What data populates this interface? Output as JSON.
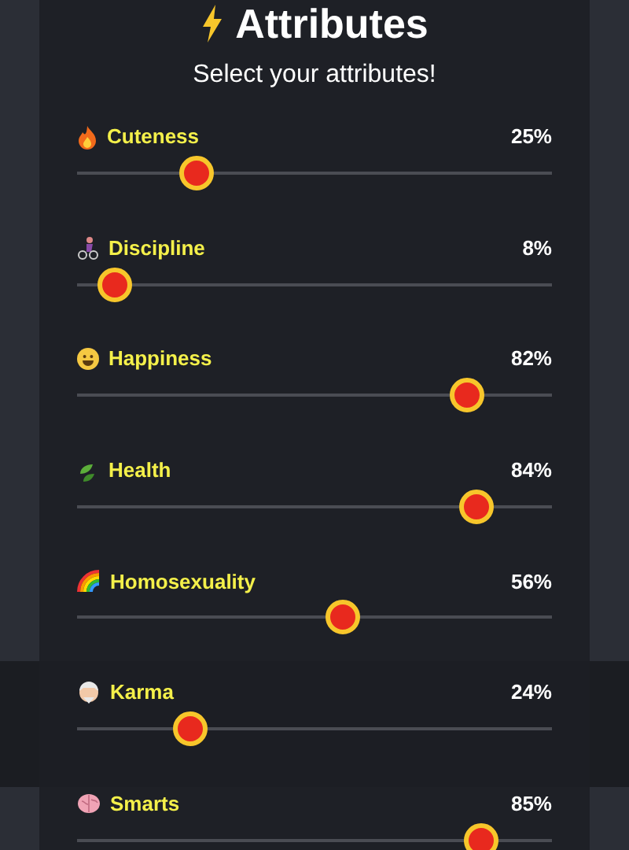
{
  "modal": {
    "title": "Attributes",
    "subtitle": "Select your attributes!",
    "attributes": [
      {
        "name": "Cuteness",
        "reading": "25%",
        "level": 0.25
      },
      {
        "name": "Discipline",
        "reading": "8%",
        "level": 0.08
      },
      {
        "name": "Happiness",
        "reading": "82%",
        "level": 0.82
      },
      {
        "name": "Health",
        "reading": "84%",
        "level": 0.84
      },
      {
        "name": "Homosexuality",
        "reading": "56%",
        "level": 0.56
      },
      {
        "name": "Karma",
        "reading": "24%",
        "level": 0.24
      },
      {
        "name": "Smarts",
        "reading": "85%",
        "level": 0.85
      }
    ]
  }
}
